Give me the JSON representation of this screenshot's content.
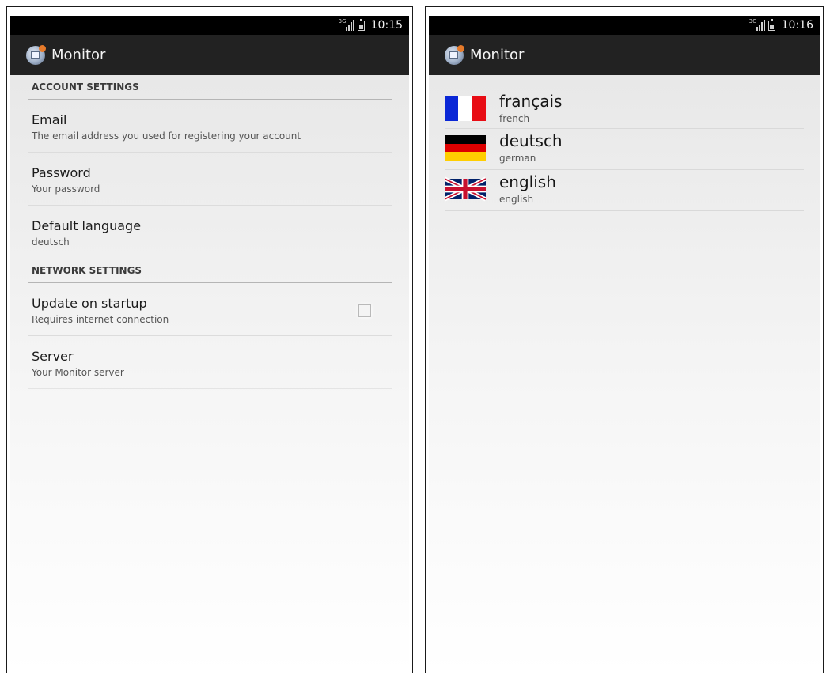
{
  "left_screen": {
    "status_bar": {
      "network_label": "3G",
      "time": "10:15"
    },
    "action_bar": {
      "title": "Monitor",
      "icon": "monitor-app-icon"
    },
    "categories": [
      {
        "title": "ACCOUNT SETTINGS",
        "items": [
          {
            "title": "Email",
            "summary": "The email address you used for registering your account"
          },
          {
            "title": "Password",
            "summary": "Your password"
          },
          {
            "title": "Default language",
            "summary": "deutsch"
          }
        ]
      },
      {
        "title": "NETWORK SETTINGS",
        "items": [
          {
            "title": "Update on startup",
            "summary": "Requires internet connection",
            "checked": false
          },
          {
            "title": "Server",
            "summary": "Your Monitor server"
          }
        ]
      }
    ]
  },
  "right_screen": {
    "status_bar": {
      "network_label": "3G",
      "time": "10:16"
    },
    "action_bar": {
      "title": "Monitor",
      "icon": "monitor-app-icon"
    },
    "languages": [
      {
        "name": "français",
        "subtitle": "french",
        "flag": "flag-france-icon",
        "colors": [
          "#0a27d6",
          "#ffffff",
          "#e80c14"
        ]
      },
      {
        "name": "deutsch",
        "subtitle": "german",
        "flag": "flag-germany-icon",
        "colors": [
          "#000000",
          "#dd0000",
          "#ffce00"
        ]
      },
      {
        "name": "english",
        "subtitle": "english",
        "flag": "flag-uk-icon",
        "colors": [
          "#012169",
          "#ffffff",
          "#c8102e"
        ]
      }
    ]
  }
}
